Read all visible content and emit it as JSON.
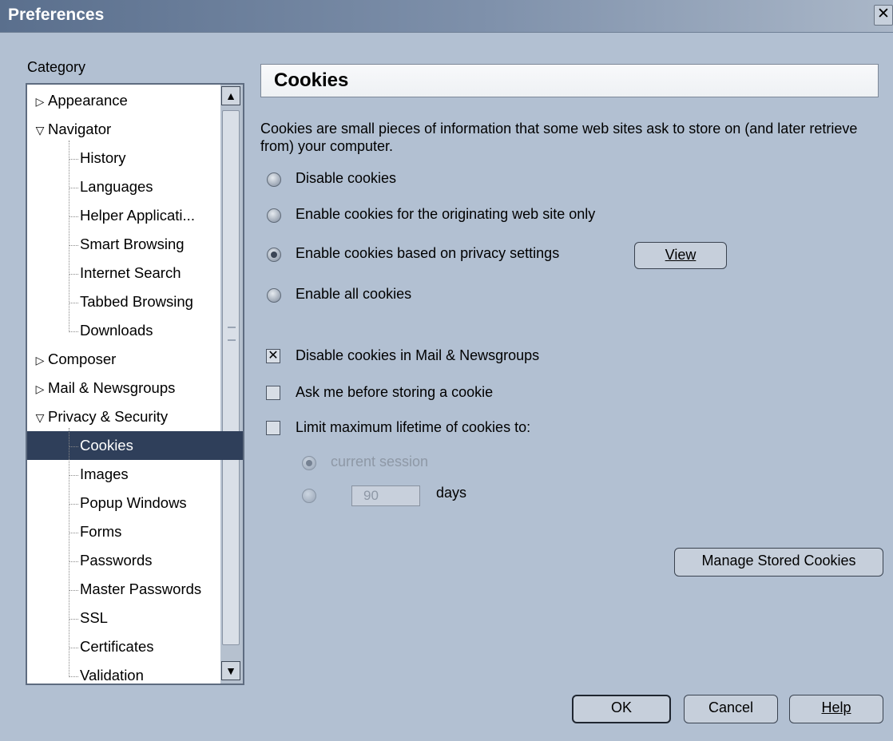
{
  "window": {
    "title": "Preferences",
    "close_glyph": "✕"
  },
  "category_label": "Category",
  "tree": {
    "items": [
      {
        "label": "Appearance",
        "level": 0,
        "expandable": true,
        "expanded": false
      },
      {
        "label": "Navigator",
        "level": 0,
        "expandable": true,
        "expanded": true
      },
      {
        "label": "History",
        "level": 1
      },
      {
        "label": "Languages",
        "level": 1
      },
      {
        "label": "Helper Applicati...",
        "level": 1
      },
      {
        "label": "Smart Browsing",
        "level": 1
      },
      {
        "label": "Internet Search",
        "level": 1
      },
      {
        "label": "Tabbed Browsing",
        "level": 1
      },
      {
        "label": "Downloads",
        "level": 1
      },
      {
        "label": "Composer",
        "level": 0,
        "expandable": true,
        "expanded": false
      },
      {
        "label": "Mail & Newsgroups",
        "level": 0,
        "expandable": true,
        "expanded": false
      },
      {
        "label": "Privacy & Security",
        "level": 0,
        "expandable": true,
        "expanded": true
      },
      {
        "label": "Cookies",
        "level": 1,
        "selected": true
      },
      {
        "label": "Images",
        "level": 1
      },
      {
        "label": "Popup Windows",
        "level": 1
      },
      {
        "label": "Forms",
        "level": 1
      },
      {
        "label": "Passwords",
        "level": 1
      },
      {
        "label": "Master Passwords",
        "level": 1
      },
      {
        "label": "SSL",
        "level": 1
      },
      {
        "label": "Certificates",
        "level": 1
      },
      {
        "label": "Validation",
        "level": 1
      }
    ],
    "arrow_collapsed": "▷",
    "arrow_expanded": "▽",
    "scroll_up_glyph": "▲",
    "scroll_down_glyph": "▼"
  },
  "panel": {
    "title": "Cookies",
    "description": "Cookies are small pieces of information that some web sites ask to store on (and later retrieve from) your computer.",
    "radios": [
      {
        "label": "Disable cookies",
        "selected": false
      },
      {
        "label": "Enable cookies for the originating web site only",
        "selected": false
      },
      {
        "label": "Enable cookies based on privacy settings",
        "selected": true
      },
      {
        "label": "Enable all cookies",
        "selected": false
      }
    ],
    "view_button": "View",
    "checkboxes": [
      {
        "label": "Disable cookies in Mail & Newsgroups",
        "checked": true
      },
      {
        "label": "Ask me before storing a cookie",
        "checked": false
      },
      {
        "label": "Limit maximum lifetime of cookies to:",
        "checked": false
      }
    ],
    "lifetime": {
      "current_session_label": "current session",
      "current_session_selected": true,
      "days_value": "90",
      "days_label": "days",
      "disabled": true
    },
    "manage_button": "Manage Stored Cookies"
  },
  "footer": {
    "ok": "OK",
    "cancel": "Cancel",
    "help": "Help"
  }
}
